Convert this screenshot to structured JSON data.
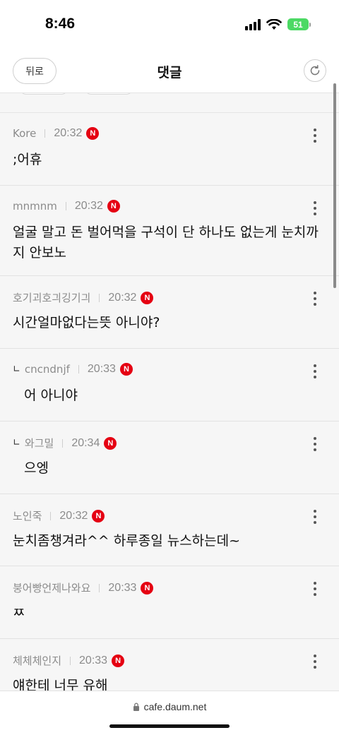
{
  "status": {
    "time": "8:46",
    "battery": "51"
  },
  "header": {
    "back_label": "뒤로",
    "title": "댓글"
  },
  "comments": [
    {
      "author": "Kore",
      "time": "20:32",
      "badge": "N",
      "text": ";어휴",
      "reply": false
    },
    {
      "author": "mnmnm",
      "time": "20:32",
      "badge": "N",
      "text": "얼굴 말고 돈 벌어먹을 구석이 단 하나도 없는게 눈치까지 안보노",
      "reply": false
    },
    {
      "author": "호기괴호긔깅기긔",
      "time": "20:32",
      "badge": "N",
      "text": "시간얼마없다는뜻 아니야?",
      "reply": false
    },
    {
      "author": "cncndnjf",
      "time": "20:33",
      "badge": "N",
      "text": "어 아니야",
      "reply": true
    },
    {
      "author": "와그밀",
      "time": "20:34",
      "badge": "N",
      "text": "으엥",
      "reply": true
    },
    {
      "author": "노인죽",
      "time": "20:32",
      "badge": "N",
      "text": "눈치좀챙겨라^^ 하루종일 뉴스하는데~",
      "reply": false
    },
    {
      "author": "붕어빵언제나와요",
      "time": "20:33",
      "badge": "N",
      "text": "ㅉ",
      "reply": false
    },
    {
      "author": "체체체인지",
      "time": "20:33",
      "badge": "N",
      "text": "얘한테 너무 유해",
      "reply": false
    }
  ],
  "browser": {
    "url": "cafe.daum.net"
  },
  "icons": {
    "refresh": "refresh-icon",
    "more": "more-vertical-icon",
    "lock": "lock-icon",
    "reply": "reply-indicator-icon"
  },
  "colors": {
    "new_badge": "#e50012",
    "battery": "#4cd964"
  }
}
